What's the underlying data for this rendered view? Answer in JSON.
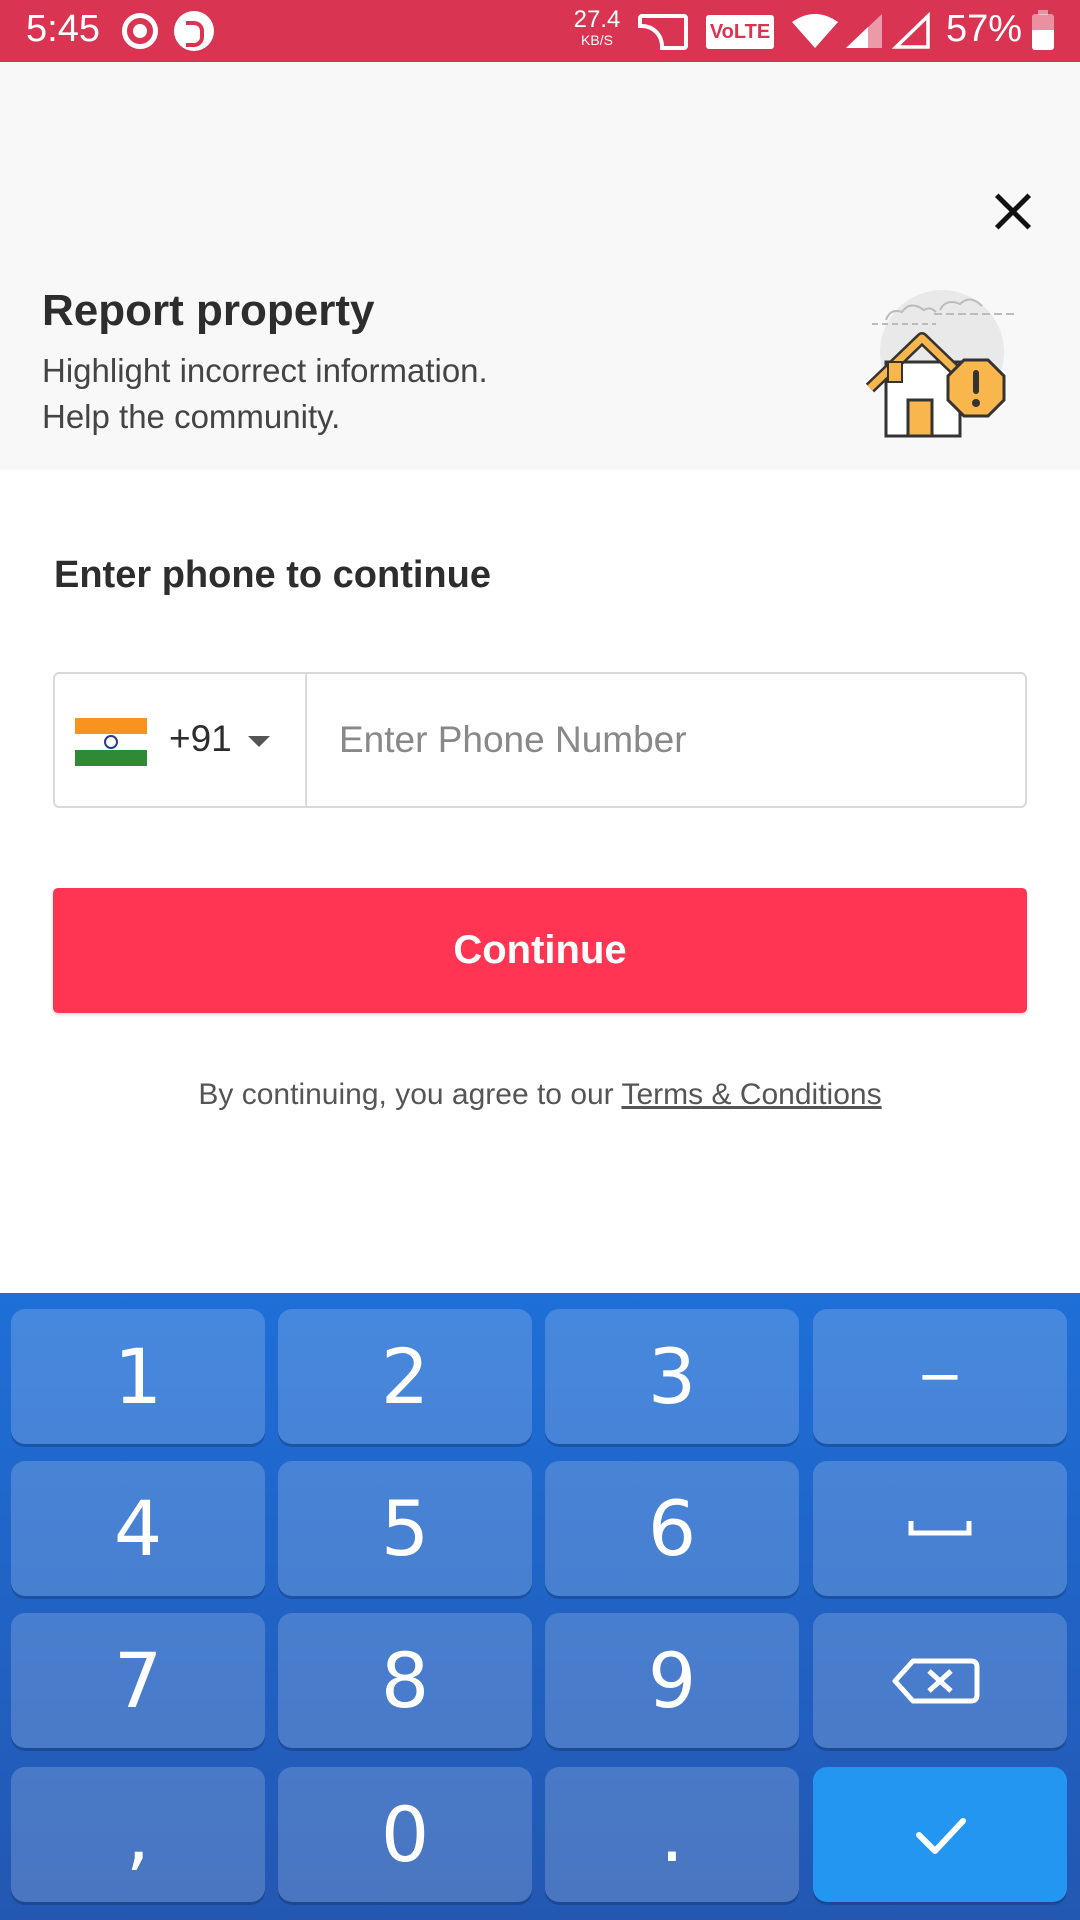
{
  "status_bar": {
    "time": "5:45",
    "net_speed_value": "27.4",
    "net_speed_unit": "KB/S",
    "volte_label": "VoLTE",
    "battery": "57%"
  },
  "header": {
    "title": "Report property",
    "subtitle_line1": "Highlight incorrect information.",
    "subtitle_line2": "Help the community."
  },
  "form": {
    "heading": "Enter phone to continue",
    "country_code": "+91",
    "phone_placeholder": "Enter Phone Number",
    "continue_label": "Continue",
    "terms_prefix": "By continuing, you agree to our ",
    "terms_link": "Terms & Conditions"
  },
  "keyboard": {
    "keys": [
      "1",
      "2",
      "3",
      "−",
      "4",
      "5",
      "6",
      "␣",
      "7",
      "8",
      "9",
      "backspace",
      ",",
      "0",
      ".",
      "done"
    ]
  },
  "colors": {
    "status_bar": "#d93552",
    "accent": "#ff3553",
    "keyboard_top": "#1e6fd8",
    "keyboard_bottom": "#2357b2",
    "done_key": "#2396f1"
  }
}
